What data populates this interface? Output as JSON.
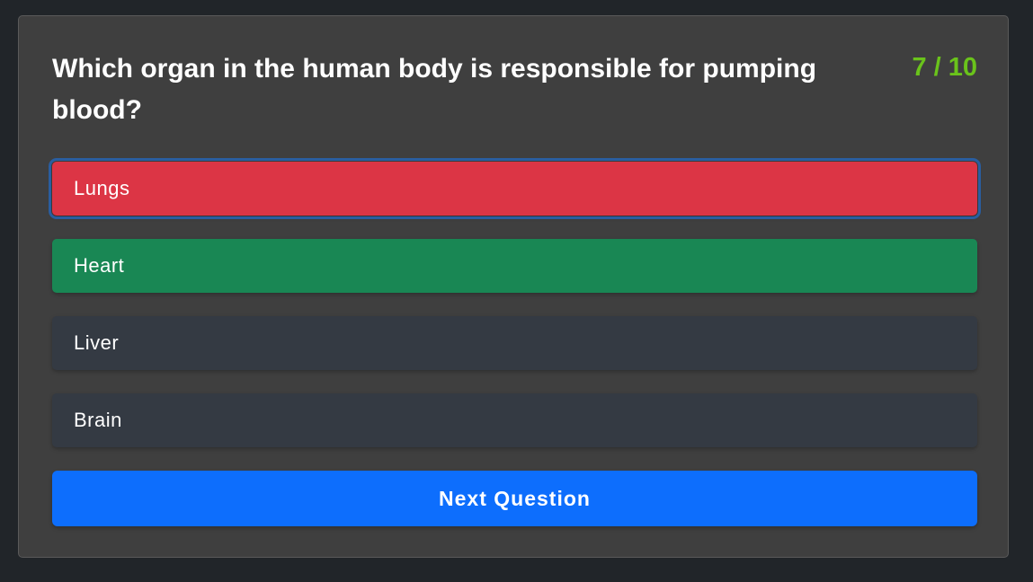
{
  "quiz": {
    "question": "Which organ in the human body is responsible for pumping blood?",
    "progress": "7 / 10",
    "answers": [
      {
        "label": "Lungs",
        "state": "selected-wrong"
      },
      {
        "label": "Heart",
        "state": "correct"
      },
      {
        "label": "Liver",
        "state": "neutral"
      },
      {
        "label": "Brain",
        "state": "neutral"
      }
    ],
    "next_label": "Next Question"
  },
  "colors": {
    "page_background": "#212529",
    "card_background": "#3f3f3f",
    "wrong": "#dc3545",
    "correct": "#198754",
    "neutral": "#343a43",
    "primary": "#0d6efd",
    "progress": "#6ac31b"
  }
}
